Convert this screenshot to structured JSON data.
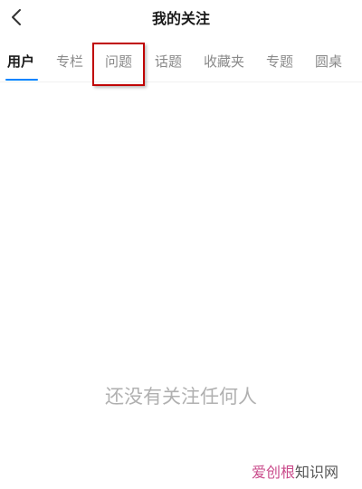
{
  "header": {
    "title": "我的关注",
    "back_icon": "chevron-left-icon"
  },
  "tabs": [
    {
      "label": "用户",
      "active": true
    },
    {
      "label": "专栏",
      "active": false
    },
    {
      "label": "问题",
      "active": false,
      "highlighted": true
    },
    {
      "label": "话题",
      "active": false
    },
    {
      "label": "收藏夹",
      "active": false
    },
    {
      "label": "专题",
      "active": false
    },
    {
      "label": "圆桌",
      "active": false
    }
  ],
  "empty_state": {
    "message": "还没有关注任何人"
  },
  "watermark": {
    "part1": "爱创根",
    "part2": "知识网"
  },
  "colors": {
    "accent": "#0084ff",
    "highlight_box": "#c00000",
    "active_text": "#1a1a1a",
    "inactive_text": "#8a8a8a",
    "empty_text": "#b0b0b0"
  }
}
